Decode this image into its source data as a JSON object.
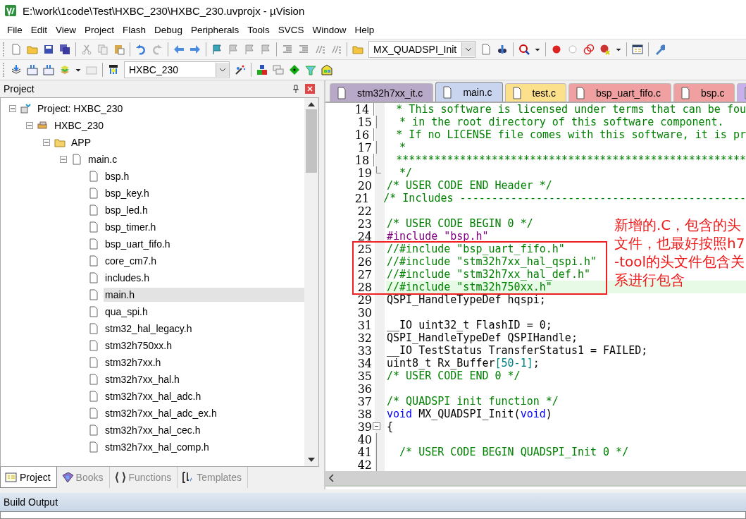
{
  "window": {
    "title": "E:\\work\\1code\\Test\\HXBC_230\\HXBC_230.uvprojx - µVision"
  },
  "menu": [
    "File",
    "Edit",
    "View",
    "Project",
    "Flash",
    "Debug",
    "Peripherals",
    "Tools",
    "SVCS",
    "Window",
    "Help"
  ],
  "toolbar": {
    "function_combo": "MX_QUADSPI_Init",
    "target_combo": "HXBC_230"
  },
  "project_panel": {
    "title": "Project",
    "tree": [
      {
        "label": "Project: HXBC_230",
        "kind": "project",
        "expanded": true,
        "selected": false,
        "children": [
          {
            "label": "HXBC_230",
            "kind": "target",
            "expanded": true,
            "selected": false,
            "children": [
              {
                "label": "APP",
                "kind": "folder",
                "expanded": true,
                "selected": false,
                "children": [
                  {
                    "label": "main.c",
                    "kind": "file",
                    "expanded": true,
                    "selected": false,
                    "children": [
                      {
                        "label": "bsp.h",
                        "kind": "file",
                        "selected": false
                      },
                      {
                        "label": "bsp_key.h",
                        "kind": "file",
                        "selected": false
                      },
                      {
                        "label": "bsp_led.h",
                        "kind": "file",
                        "selected": false
                      },
                      {
                        "label": "bsp_timer.h",
                        "kind": "file",
                        "selected": false
                      },
                      {
                        "label": "bsp_uart_fifo.h",
                        "kind": "file",
                        "selected": false
                      },
                      {
                        "label": "core_cm7.h",
                        "kind": "file",
                        "selected": false
                      },
                      {
                        "label": "includes.h",
                        "kind": "file",
                        "selected": false
                      },
                      {
                        "label": "main.h",
                        "kind": "file",
                        "selected": true
                      },
                      {
                        "label": "qua_spi.h",
                        "kind": "file",
                        "selected": false
                      },
                      {
                        "label": "stm32_hal_legacy.h",
                        "kind": "file",
                        "selected": false
                      },
                      {
                        "label": "stm32h750xx.h",
                        "kind": "file",
                        "selected": false
                      },
                      {
                        "label": "stm32h7xx.h",
                        "kind": "file",
                        "selected": false
                      },
                      {
                        "label": "stm32h7xx_hal.h",
                        "kind": "file",
                        "selected": false
                      },
                      {
                        "label": "stm32h7xx_hal_adc.h",
                        "kind": "file",
                        "selected": false
                      },
                      {
                        "label": "stm32h7xx_hal_adc_ex.h",
                        "kind": "file",
                        "selected": false
                      },
                      {
                        "label": "stm32h7xx_hal_cec.h",
                        "kind": "file",
                        "selected": false
                      },
                      {
                        "label": "stm32h7xx_hal_comp.h",
                        "kind": "file",
                        "selected": false
                      }
                    ]
                  }
                ]
              }
            ]
          }
        ]
      }
    ],
    "tabs": [
      {
        "label": "Project",
        "kind": "project",
        "selected": true
      },
      {
        "label": "Books",
        "kind": "books",
        "selected": false
      },
      {
        "label": "Functions",
        "kind": "functions",
        "selected": false
      },
      {
        "label": "Templates",
        "kind": "templates",
        "selected": false
      }
    ]
  },
  "editor": {
    "tabs": [
      {
        "label": "stm32h7xx_it.c",
        "color": "#b9a9c9",
        "selected": false
      },
      {
        "label": "main.c",
        "color": "#c9d5ef",
        "selected": true
      },
      {
        "label": "test.c",
        "color": "#fde08b",
        "selected": false
      },
      {
        "label": "bsp_uart_fifo.c",
        "color": "#f0a0a0",
        "selected": false
      },
      {
        "label": "bsp.c",
        "color": "#f0a0a0",
        "selected": false
      },
      {
        "color": "#c8b0ec",
        "selected": false
      }
    ],
    "lines": [
      {
        "n": "14",
        "kind": "fold-line",
        "current": false,
        "tokens": [
          {
            "kind": "comment",
            "text": "  * This software is licensed under terms that can be fou"
          }
        ]
      },
      {
        "n": "15",
        "kind": "fold-line",
        "current": false,
        "tokens": [
          {
            "kind": "comment",
            "text": "  * in the root directory of this software component."
          }
        ]
      },
      {
        "n": "16",
        "kind": "fold-line",
        "current": false,
        "tokens": [
          {
            "kind": "comment",
            "text": "  * If no LICENSE file comes with this software, it is pr"
          }
        ]
      },
      {
        "n": "17",
        "kind": "fold-line",
        "current": false,
        "tokens": [
          {
            "kind": "comment",
            "text": "  *"
          }
        ]
      },
      {
        "n": "18",
        "kind": "fold-line",
        "current": false,
        "tokens": [
          {
            "kind": "comment",
            "text": "  *******************************************************"
          }
        ]
      },
      {
        "n": "19",
        "kind": "fold-end",
        "current": false,
        "tokens": [
          {
            "kind": "comment",
            "text": "  */"
          }
        ]
      },
      {
        "n": "20",
        "kind": "code",
        "current": false,
        "tokens": [
          {
            "kind": "comment",
            "text": "/* USER CODE END Header */"
          }
        ]
      },
      {
        "n": "21",
        "kind": "code",
        "current": false,
        "tokens": [
          {
            "kind": "comment",
            "text": "/* Includes ---------------------------------------------"
          }
        ]
      },
      {
        "n": "22",
        "kind": "code",
        "current": false
      },
      {
        "n": "23",
        "kind": "code",
        "current": false,
        "tokens": [
          {
            "kind": "comment",
            "text": "/* USER CODE BEGIN 0 */"
          }
        ]
      },
      {
        "n": "24",
        "kind": "code",
        "current": false,
        "tokens": [
          {
            "kind": "preprocessor",
            "text": "#include \"bsp.h\""
          }
        ]
      },
      {
        "n": "25",
        "kind": "code",
        "current": false,
        "tokens": [
          {
            "kind": "comment",
            "text": "//#include \"bsp_uart_fifo.h\""
          }
        ]
      },
      {
        "n": "26",
        "kind": "code",
        "current": false,
        "tokens": [
          {
            "kind": "comment",
            "text": "//#include \"stm32h7xx_hal_qspi.h\""
          }
        ]
      },
      {
        "n": "27",
        "kind": "code",
        "current": false,
        "tokens": [
          {
            "kind": "comment",
            "text": "//#include \"stm32h7xx_hal_def.h\""
          }
        ]
      },
      {
        "n": "28",
        "kind": "code",
        "current": true,
        "tokens": [
          {
            "kind": "comment",
            "text": "//#include \"stm32h750xx.h\""
          }
        ]
      },
      {
        "n": "29",
        "kind": "code",
        "current": false,
        "tokens": [
          {
            "kind": "plain",
            "text": "QSPI_HandleTypeDef hqspi;"
          }
        ]
      },
      {
        "n": "30",
        "kind": "code",
        "current": false
      },
      {
        "n": "31",
        "kind": "code",
        "current": false,
        "tokens": [
          {
            "kind": "plain",
            "text": "__IO uint32_t FlashID = 0;"
          }
        ]
      },
      {
        "n": "32",
        "kind": "code",
        "current": false,
        "tokens": [
          {
            "kind": "plain",
            "text": "QSPI_HandleTypeDef QSPIHandle;"
          }
        ]
      },
      {
        "n": "33",
        "kind": "code",
        "current": false,
        "tokens": [
          {
            "kind": "plain",
            "text": "__IO TestStatus TransferStatus1 = FAILED;"
          }
        ]
      },
      {
        "n": "34",
        "kind": "code",
        "current": false,
        "tokens": [
          {
            "kind": "plain",
            "text": "uint8_t Rx_Buffer"
          },
          {
            "kind": "number",
            "text": "[50-1]"
          },
          {
            "kind": "plain",
            "text": ";"
          }
        ]
      },
      {
        "n": "35",
        "kind": "code",
        "current": false,
        "tokens": [
          {
            "kind": "comment",
            "text": "/* USER CODE END 0 */"
          }
        ]
      },
      {
        "n": "36",
        "kind": "code",
        "current": false
      },
      {
        "n": "37",
        "kind": "code",
        "current": false,
        "tokens": [
          {
            "kind": "comment",
            "text": "/* QUADSPI init function */"
          }
        ]
      },
      {
        "n": "38",
        "kind": "code",
        "current": false,
        "tokens": [
          {
            "kind": "keyword",
            "text": "void"
          },
          {
            "kind": "plain",
            "text": " MX_QUADSPI_Init("
          },
          {
            "kind": "keyword",
            "text": "void"
          },
          {
            "kind": "plain",
            "text": ")"
          }
        ]
      },
      {
        "n": "39",
        "kind": "fold-start",
        "current": false,
        "tokens": [
          {
            "kind": "plain",
            "text": "{"
          }
        ]
      },
      {
        "n": "40",
        "kind": "fold-line",
        "current": false
      },
      {
        "n": "41",
        "kind": "fold-line",
        "current": false,
        "tokens": [
          {
            "kind": "comment",
            "text": "  /* USER CODE BEGIN QUADSPI_Init 0 */"
          }
        ]
      },
      {
        "n": "42",
        "kind": "fold-line",
        "current": false
      }
    ],
    "annotation": {
      "text": "新增的.C，包含的头文件，也最好按照h7-tool的头文件包含关系进行包含"
    }
  },
  "build_output": {
    "title": "Build Output"
  }
}
